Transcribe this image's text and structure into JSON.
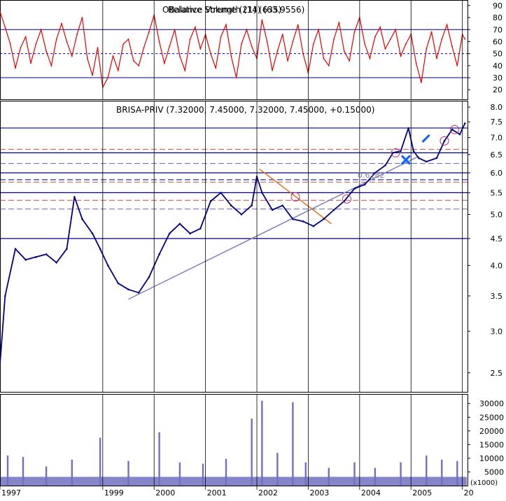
{
  "rsi_panel": {
    "title": "Relative Strength (14) (63.9556)",
    "overlay_title": "OBalance Volume (21) (635)",
    "color": "#e00000",
    "ylim": [
      12,
      94
    ],
    "ticks": [
      "90",
      "80",
      "70",
      "60",
      "50",
      "40",
      "30",
      "20"
    ],
    "tick_values": [
      90,
      80,
      70,
      60,
      50,
      40,
      30,
      20
    ],
    "upper_band": 70,
    "mid_line": 50,
    "lower_band": 30
  },
  "price_panel": {
    "title": "BRISA-PRIV (7.32000, 7.45000, 7.32000, 7.45000, +0.15000)",
    "color": "#000080",
    "ylim": [
      2.3,
      8.2
    ],
    "scale": "log",
    "ticks": [
      "8.0",
      "7.5",
      "7.0",
      "6.5",
      "6.0",
      "5.5",
      "5.0",
      "4.5",
      "4.0",
      "3.5",
      "3.0",
      "2.5"
    ],
    "tick_values": [
      8.0,
      7.5,
      7.0,
      6.5,
      6.0,
      5.5,
      5.0,
      4.5,
      4.0,
      3.5,
      3.0,
      2.5
    ],
    "annotation": "0.6182",
    "horizontal_levels": [
      {
        "value": 7.3,
        "style": "solid",
        "color": "#000080"
      },
      {
        "value": 6.65,
        "style": "dashed",
        "color": "#c0504d"
      },
      {
        "value": 6.55,
        "style": "solid",
        "color": "#000080"
      },
      {
        "value": 6.25,
        "style": "dashed",
        "color": "#6060c0"
      },
      {
        "value": 6.0,
        "style": "solid",
        "color": "#000080"
      },
      {
        "value": 5.82,
        "style": "dashed",
        "color": "#000080"
      },
      {
        "value": 5.76,
        "style": "dashed",
        "color": "#c0504d"
      },
      {
        "value": 5.5,
        "style": "solid",
        "color": "#000080"
      },
      {
        "value": 5.32,
        "style": "dashed",
        "color": "#c0504d"
      },
      {
        "value": 5.12,
        "style": "dashed",
        "color": "#6060c0"
      },
      {
        "value": 4.5,
        "style": "solid",
        "color": "#000080"
      }
    ]
  },
  "volume_panel": {
    "color": "#7070c0",
    "ylim": [
      0,
      33000
    ],
    "ticks": [
      "30000",
      "25000",
      "20000",
      "15000",
      "10000",
      "5000"
    ],
    "tick_values": [
      30000,
      25000,
      20000,
      15000,
      10000,
      5000
    ],
    "unit_label": "(x1000)"
  },
  "x_axis": {
    "labels": [
      "1997",
      "1999",
      "2000",
      "2001",
      "2002",
      "2003",
      "2004",
      "2005",
      "20"
    ],
    "label_years": [
      1997.0,
      1999.0,
      2000.0,
      2001.0,
      2002.0,
      2003.0,
      2004.0,
      2005.0,
      2006.0
    ]
  },
  "chart_data": {
    "type": "line",
    "x_range": [
      1997.0,
      2006.1
    ],
    "price_series": {
      "name": "BRISA-PRIV",
      "x": [
        1997.0,
        1997.1,
        1997.3,
        1997.5,
        1997.7,
        1997.9,
        1998.1,
        1998.3,
        1998.45,
        1998.6,
        1998.8,
        1998.95,
        1999.1,
        1999.3,
        1999.5,
        1999.7,
        1999.9,
        2000.1,
        2000.3,
        2000.5,
        2000.7,
        2000.9,
        2001.1,
        2001.3,
        2001.5,
        2001.7,
        2001.9,
        2002.0,
        2002.1,
        2002.3,
        2002.5,
        2002.7,
        2002.9,
        2003.1,
        2003.3,
        2003.5,
        2003.7,
        2003.9,
        2004.1,
        2004.3,
        2004.5,
        2004.65,
        2004.8,
        2004.95,
        2005.05,
        2005.15,
        2005.3,
        2005.5,
        2005.65,
        2005.8,
        2005.95,
        2006.05
      ],
      "y": [
        2.6,
        3.5,
        4.3,
        4.1,
        4.15,
        4.2,
        4.05,
        4.3,
        5.4,
        4.9,
        4.6,
        4.3,
        4.0,
        3.7,
        3.6,
        3.55,
        3.8,
        4.2,
        4.6,
        4.8,
        4.6,
        4.7,
        5.3,
        5.5,
        5.2,
        5.0,
        5.2,
        5.9,
        5.5,
        5.1,
        5.2,
        4.9,
        4.85,
        4.75,
        4.9,
        5.1,
        5.3,
        5.6,
        5.7,
        6.0,
        6.2,
        6.55,
        6.6,
        7.3,
        6.6,
        6.4,
        6.3,
        6.4,
        6.9,
        7.25,
        7.1,
        7.45
      ]
    },
    "rsi_series": {
      "name": "Relative Strength (14)",
      "x": [
        1997.0,
        1997.1,
        1997.2,
        1997.3,
        1997.4,
        1997.5,
        1997.6,
        1997.7,
        1997.8,
        1997.9,
        1998.0,
        1998.1,
        1998.2,
        1998.3,
        1998.4,
        1998.5,
        1998.6,
        1998.7,
        1998.8,
        1998.9,
        1999.0,
        1999.1,
        1999.2,
        1999.3,
        1999.4,
        1999.5,
        1999.6,
        1999.7,
        1999.8,
        1999.9,
        2000.0,
        2000.1,
        2000.2,
        2000.3,
        2000.4,
        2000.5,
        2000.6,
        2000.7,
        2000.8,
        2000.9,
        2001.0,
        2001.1,
        2001.2,
        2001.3,
        2001.4,
        2001.5,
        2001.6,
        2001.7,
        2001.8,
        2001.9,
        2002.0,
        2002.1,
        2002.2,
        2002.3,
        2002.4,
        2002.5,
        2002.6,
        2002.7,
        2002.8,
        2002.9,
        2003.0,
        2003.1,
        2003.2,
        2003.3,
        2003.4,
        2003.5,
        2003.6,
        2003.7,
        2003.8,
        2003.9,
        2004.0,
        2004.1,
        2004.2,
        2004.3,
        2004.4,
        2004.5,
        2004.6,
        2004.7,
        2004.8,
        2004.9,
        2005.0,
        2005.1,
        2005.2,
        2005.3,
        2005.4,
        2005.5,
        2005.6,
        2005.7,
        2005.8,
        2005.9,
        2006.0,
        2006.05
      ],
      "y": [
        85,
        72,
        58,
        38,
        55,
        64,
        42,
        58,
        70,
        52,
        40,
        62,
        75,
        60,
        48,
        66,
        80,
        46,
        32,
        55,
        22,
        30,
        48,
        36,
        58,
        62,
        44,
        40,
        55,
        68,
        82,
        60,
        42,
        56,
        70,
        48,
        36,
        62,
        72,
        54,
        66,
        50,
        38,
        64,
        74,
        48,
        30,
        58,
        70,
        56,
        46,
        78,
        60,
        36,
        52,
        66,
        44,
        60,
        74,
        50,
        34,
        58,
        70,
        46,
        40,
        62,
        76,
        52,
        44,
        68,
        80,
        58,
        46,
        64,
        72,
        54,
        62,
        70,
        48,
        58,
        66,
        42,
        26,
        54,
        68,
        46,
        62,
        74,
        56,
        40,
        66,
        62
      ]
    },
    "volume_series": {
      "name": "Volume",
      "x": [
        1997.15,
        1997.45,
        1997.9,
        1998.4,
        1998.95,
        1999.5,
        2000.1,
        2000.5,
        2000.95,
        2001.4,
        2001.9,
        2002.1,
        2002.4,
        2002.7,
        2002.95,
        2003.4,
        2003.9,
        2004.3,
        2004.8,
        2005.3,
        2005.6,
        2005.9
      ],
      "y": [
        11000,
        10500,
        7000,
        9500,
        17500,
        9000,
        19500,
        8500,
        8000,
        9800,
        24500,
        31000,
        12000,
        30500,
        8500,
        6500,
        8500,
        6500,
        8500,
        11000,
        9500,
        9000
      ]
    }
  }
}
